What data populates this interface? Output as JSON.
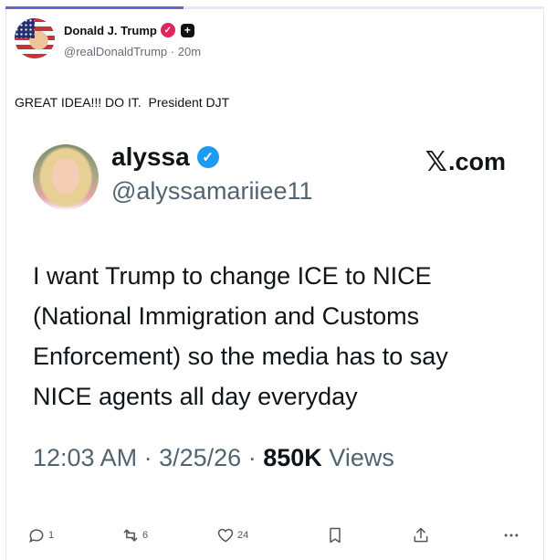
{
  "progress": {
    "fraction": 0.33,
    "color": "#6a64cf"
  },
  "post": {
    "author_name": "Donald J. Trump",
    "handle": "@realDonaldTrump",
    "separator": "·",
    "time": "20m",
    "text": "GREAT IDEA!!! DO IT.  President DJT"
  },
  "quote": {
    "author_name": "alyssa",
    "handle": "@alyssamariiee11",
    "source": ".com",
    "body_lines": [
      "I want Trump to change ICE to NICE",
      "(National Immigration and Customs",
      "Enforcement) so the media has to say",
      "NICE agents all day everyday"
    ],
    "time": "12:03 AM",
    "date": "3/25/26",
    "separator": "·",
    "views_count": "850K",
    "views_label": "Views"
  },
  "actions": {
    "replies": "1",
    "reposts": "6",
    "likes": "24"
  },
  "icons": [
    "verified-badge-icon",
    "plus-badge-icon",
    "x-logo-icon",
    "reply-icon",
    "repost-icon",
    "heart-icon",
    "bookmark-icon",
    "share-icon",
    "more-icon"
  ],
  "colors": {
    "verified_blue": "#1d9bf0",
    "verified_pink": "#e0245e",
    "muted": "#536471"
  }
}
